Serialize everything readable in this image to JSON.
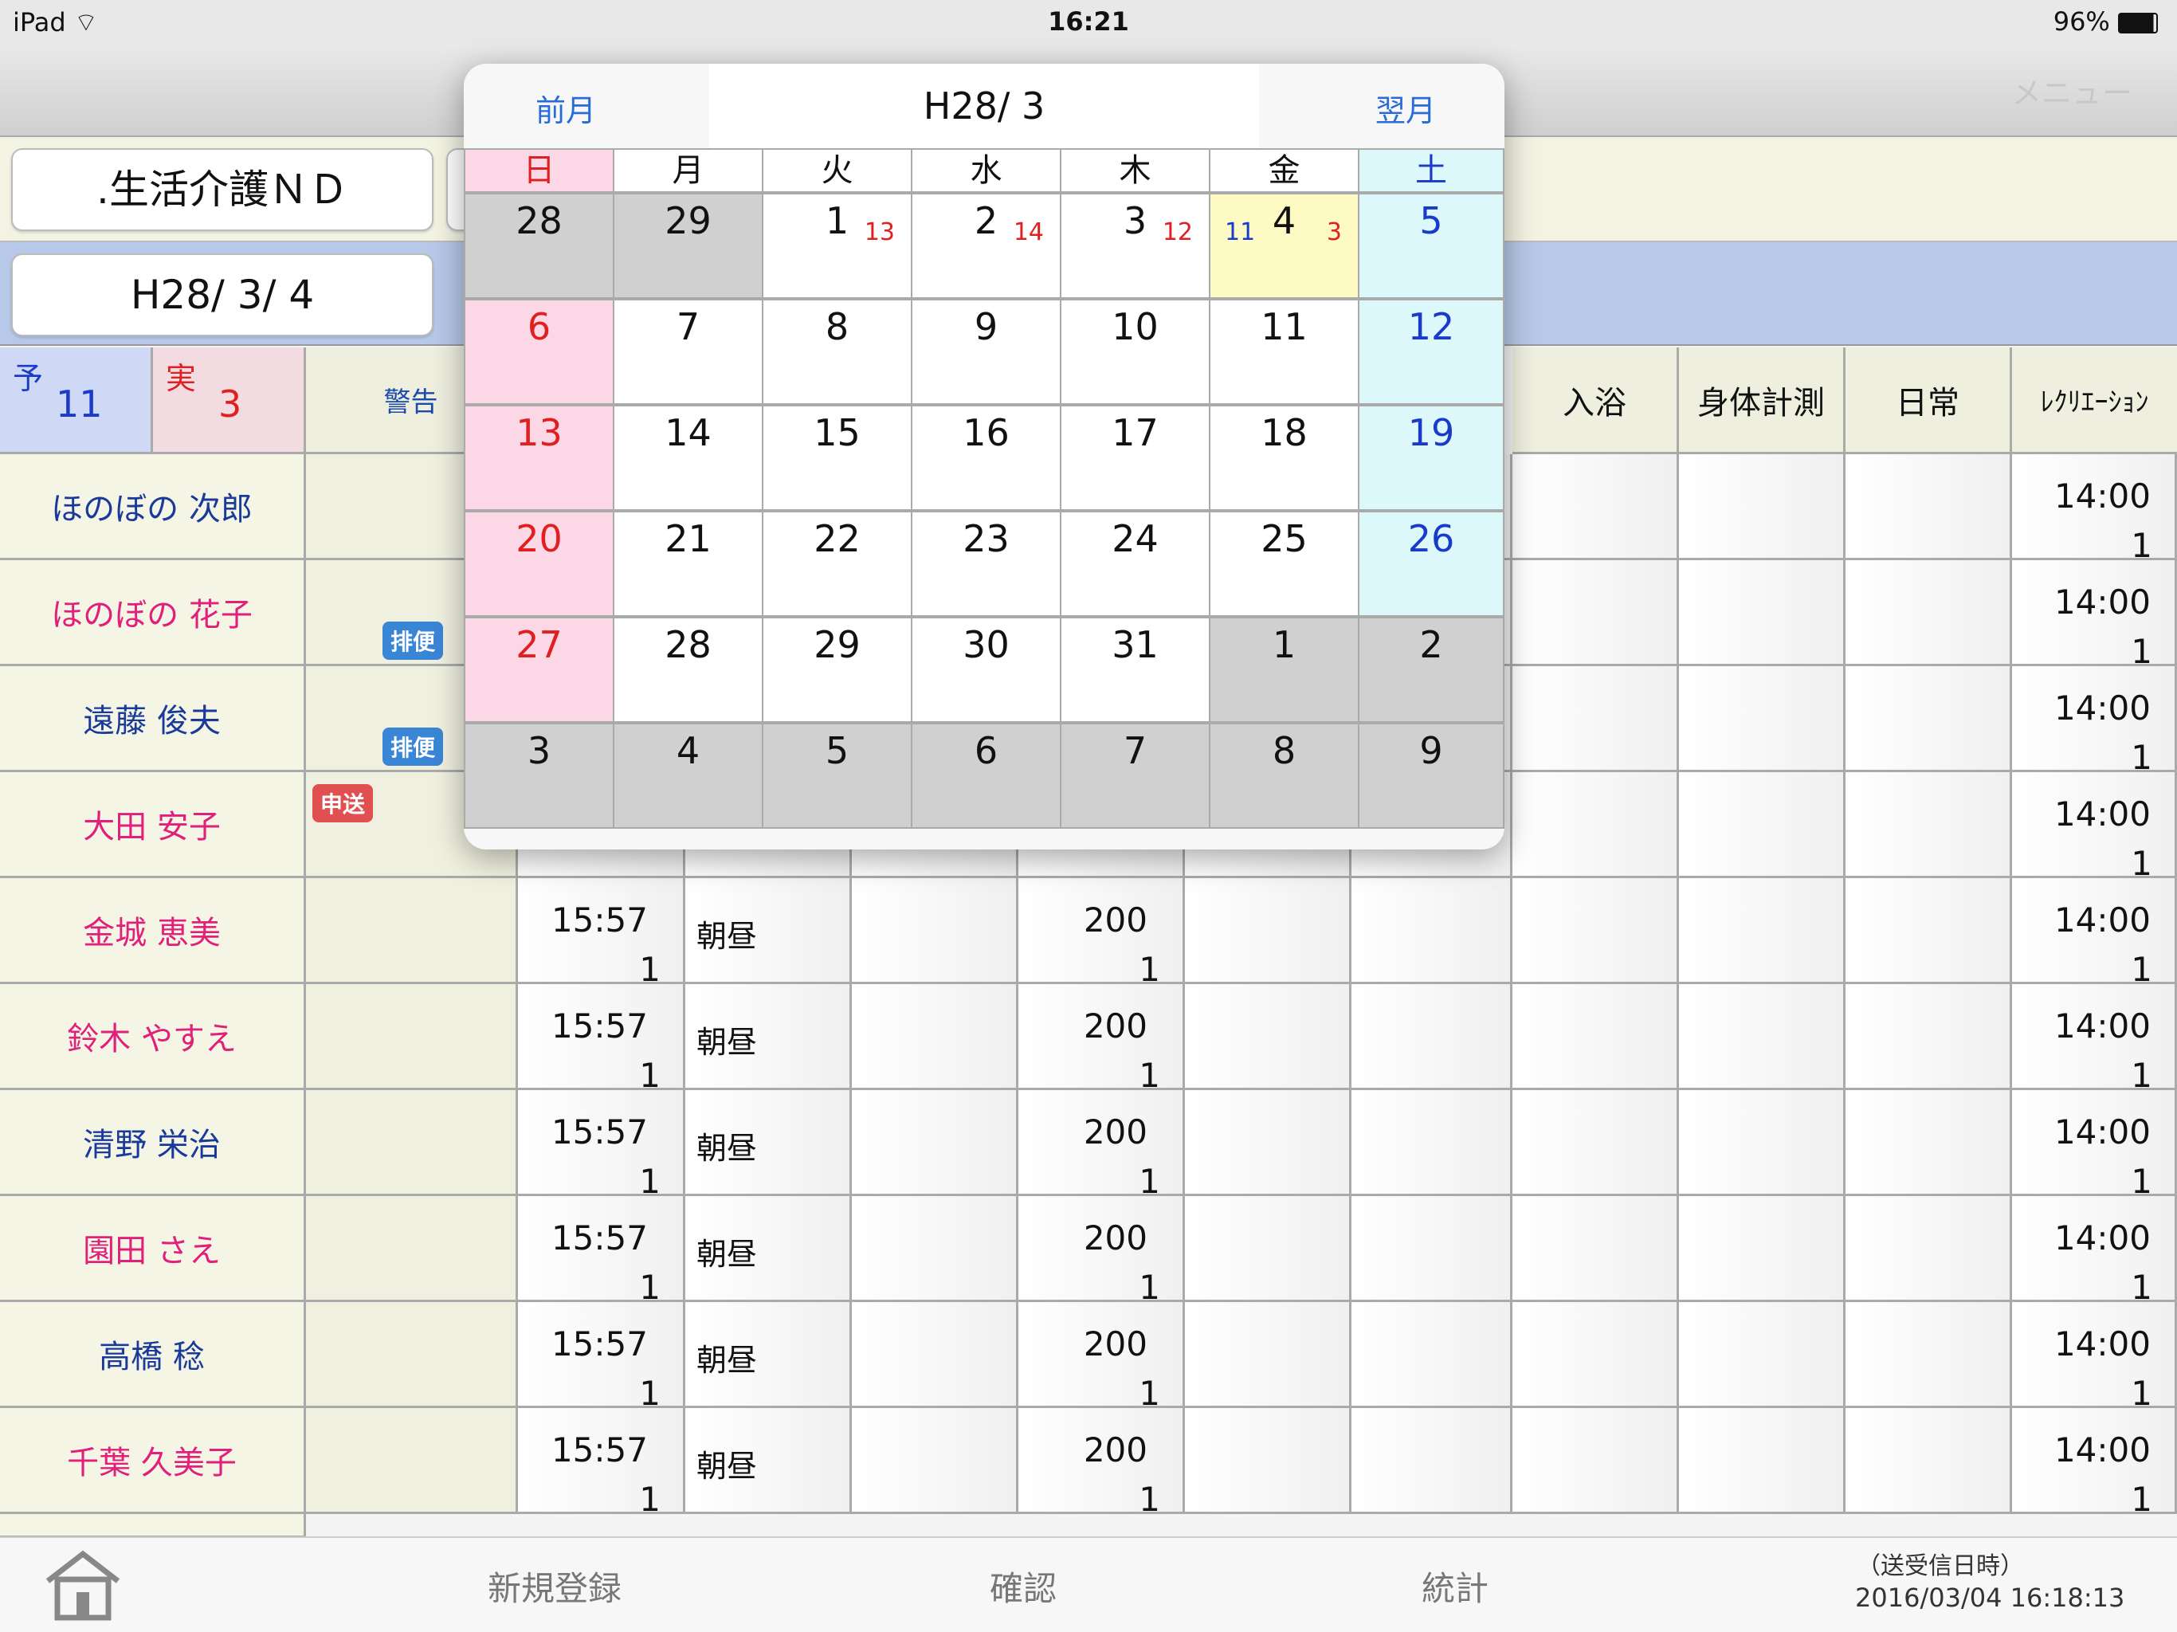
{
  "status_bar": {
    "device": "iPad",
    "time": "16:21",
    "battery": "96%"
  },
  "menu_label": "メニュー",
  "facility": ".生活介護ＮＤ",
  "current_date": "H28/ 3/ 4",
  "counts": {
    "planned_label": "予",
    "planned": "11",
    "actual_label": "実",
    "actual": "3"
  },
  "warning_header": "警告",
  "column_headers": [
    "入浴",
    "身体計測",
    "日常",
    "ﾚｸﾘｴｰｼｮﾝ"
  ],
  "badges": {
    "haiben": "排便",
    "moushiokuri": "申送"
  },
  "people": [
    {
      "name": "ほのぼの 次郎",
      "color": "blue"
    },
    {
      "name": "ほのぼの 花子",
      "color": "pink"
    },
    {
      "name": "遠藤 俊夫",
      "color": "blue"
    },
    {
      "name": "大田 安子",
      "color": "pink"
    },
    {
      "name": "金城 恵美",
      "color": "pink"
    },
    {
      "name": "鈴木 やすえ",
      "color": "pink"
    },
    {
      "name": "清野 栄治",
      "color": "blue"
    },
    {
      "name": "園田 さえ",
      "color": "pink"
    },
    {
      "name": "高橋 稔",
      "color": "blue"
    },
    {
      "name": "千葉 久美子",
      "color": "pink"
    }
  ],
  "row_values": {
    "time": "15:57",
    "one": "1",
    "meal": "朝昼",
    "amount": "200",
    "rec_time": "14:00"
  },
  "calendar": {
    "prev": "前月",
    "next": "翌月",
    "title": "H28/ 3",
    "weekdays": [
      "日",
      "月",
      "火",
      "水",
      "木",
      "金",
      "土"
    ],
    "days": [
      {
        "n": "28",
        "t": "oth"
      },
      {
        "n": "29",
        "t": "oth"
      },
      {
        "n": "1",
        "t": "",
        "s1": "13"
      },
      {
        "n": "2",
        "t": "",
        "s1": "14"
      },
      {
        "n": "3",
        "t": "",
        "s1": "12"
      },
      {
        "n": "4",
        "t": "today",
        "s0": "11",
        "s1": "3"
      },
      {
        "n": "5",
        "t": "sat"
      },
      {
        "n": "6",
        "t": "sun"
      },
      {
        "n": "7",
        "t": ""
      },
      {
        "n": "8",
        "t": ""
      },
      {
        "n": "9",
        "t": ""
      },
      {
        "n": "10",
        "t": ""
      },
      {
        "n": "11",
        "t": ""
      },
      {
        "n": "12",
        "t": "sat"
      },
      {
        "n": "13",
        "t": "sun"
      },
      {
        "n": "14",
        "t": ""
      },
      {
        "n": "15",
        "t": ""
      },
      {
        "n": "16",
        "t": ""
      },
      {
        "n": "17",
        "t": ""
      },
      {
        "n": "18",
        "t": ""
      },
      {
        "n": "19",
        "t": "sat"
      },
      {
        "n": "20",
        "t": "sun"
      },
      {
        "n": "21",
        "t": ""
      },
      {
        "n": "22",
        "t": ""
      },
      {
        "n": "23",
        "t": ""
      },
      {
        "n": "24",
        "t": ""
      },
      {
        "n": "25",
        "t": ""
      },
      {
        "n": "26",
        "t": "sat"
      },
      {
        "n": "27",
        "t": "sun"
      },
      {
        "n": "28",
        "t": ""
      },
      {
        "n": "29",
        "t": ""
      },
      {
        "n": "30",
        "t": ""
      },
      {
        "n": "31",
        "t": ""
      },
      {
        "n": "1",
        "t": "oth"
      },
      {
        "n": "2",
        "t": "oth"
      },
      {
        "n": "3",
        "t": "oth"
      },
      {
        "n": "4",
        "t": "oth"
      },
      {
        "n": "5",
        "t": "oth"
      },
      {
        "n": "6",
        "t": "oth"
      },
      {
        "n": "7",
        "t": "oth"
      },
      {
        "n": "8",
        "t": "oth"
      },
      {
        "n": "9",
        "t": "oth"
      }
    ]
  },
  "tabs": {
    "new": "新規登録",
    "confirm": "確認",
    "stats": "統計"
  },
  "sync": {
    "label": "（送受信日時）",
    "datetime": "2016/03/04 16:18:13"
  },
  "colors": {
    "sun_red": "#e02020",
    "sat_blue": "#1a3aca",
    "accent": "#2a6cd6"
  }
}
